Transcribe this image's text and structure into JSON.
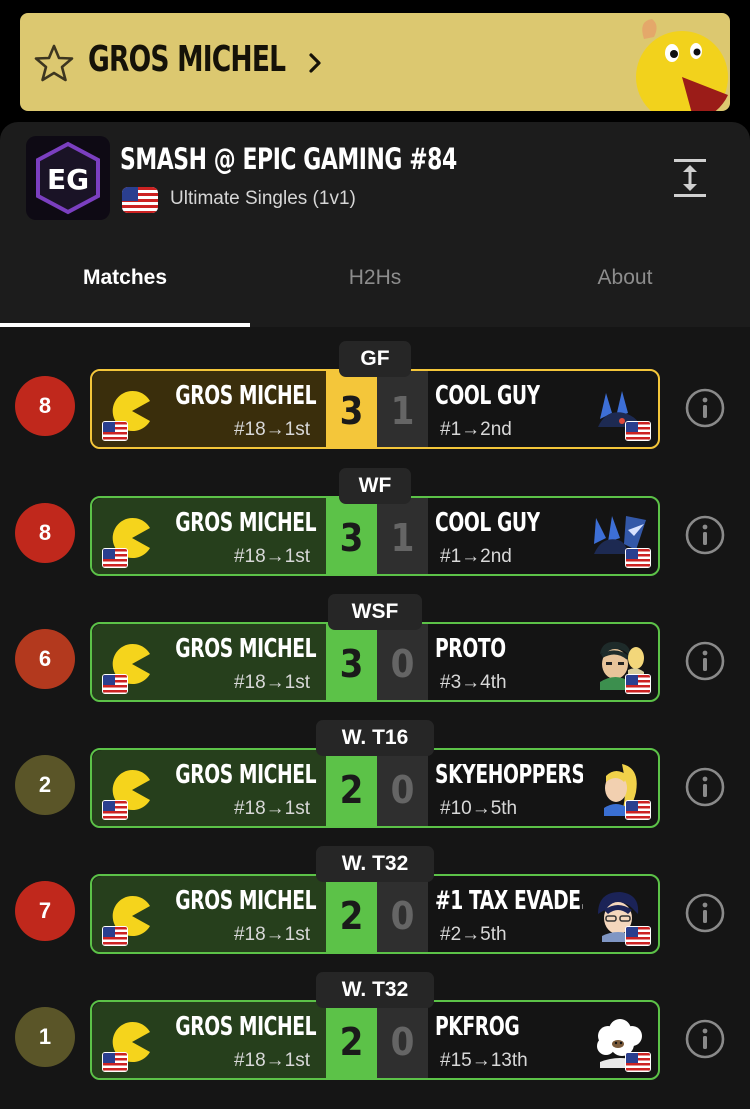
{
  "banner": {
    "player_name": "GROS MICHEL"
  },
  "tournament": {
    "logo_text": "EG",
    "title": "SMASH @ EPIC GAMING #84",
    "event": "Ultimate Singles (1v1)"
  },
  "tabs": [
    {
      "label": "Matches",
      "active": true
    },
    {
      "label": "H2Hs",
      "active": false
    },
    {
      "label": "About",
      "active": false
    }
  ],
  "colors": {
    "banner": "#dcc870",
    "win_gold": "#f4c63a",
    "win_green": "#5cc248",
    "gold_bg": "#3a2e0c",
    "green_bg": "#263f1c"
  },
  "matches": [
    {
      "seed": "8",
      "seed_color": "#c0281c",
      "round": "GF",
      "win_style": "gold",
      "player": "GROS MICHEL",
      "player_seed": "#18→1st",
      "player_score": "3",
      "opponent": "COOL GUY",
      "opponent_seed": "#1→2nd",
      "opponent_score": "1",
      "opponent_icon": "lucario-icon"
    },
    {
      "seed": "8",
      "seed_color": "#c0281c",
      "round": "WF",
      "win_style": "green",
      "player": "GROS MICHEL",
      "player_seed": "#18→1st",
      "player_score": "3",
      "opponent": "COOL GUY",
      "opponent_seed": "#1→2nd",
      "opponent_score": "1",
      "opponent_icon": "lucario-greninja-icon"
    },
    {
      "seed": "6",
      "seed_color": "#b3391e",
      "round": "WSF",
      "win_style": "green",
      "player": "GROS MICHEL",
      "player_seed": "#18→1st",
      "player_score": "3",
      "opponent": "PROTO",
      "opponent_seed": "#3→4th",
      "opponent_score": "0",
      "opponent_icon": "byleth-icon"
    },
    {
      "seed": "2",
      "seed_color": "#5a5528",
      "round": "W. T16",
      "win_style": "green",
      "player": "GROS MICHEL",
      "player_seed": "#18→1st",
      "player_score": "2",
      "opponent": "SKYEHOPPERS",
      "opponent_seed": "#10→5th",
      "opponent_score": "0",
      "opponent_icon": "zero-suit-samus-icon"
    },
    {
      "seed": "7",
      "seed_color": "#c0281c",
      "round": "W. T32",
      "win_style": "green",
      "player": "GROS MICHEL",
      "player_seed": "#18→1st",
      "player_score": "2",
      "opponent": "#1 TAX EVADE...",
      "opponent_seed": "#2→5th",
      "opponent_score": "0",
      "opponent_icon": "marth-icon"
    },
    {
      "seed": "1",
      "seed_color": "#5a5528",
      "round": "W. T32",
      "win_style": "green",
      "player": "GROS MICHEL",
      "player_seed": "#18→1st",
      "player_score": "2",
      "opponent": "PKFROG",
      "opponent_seed": "#15→13th",
      "opponent_score": "0",
      "opponent_icon": "ice-climbers-icon"
    }
  ]
}
